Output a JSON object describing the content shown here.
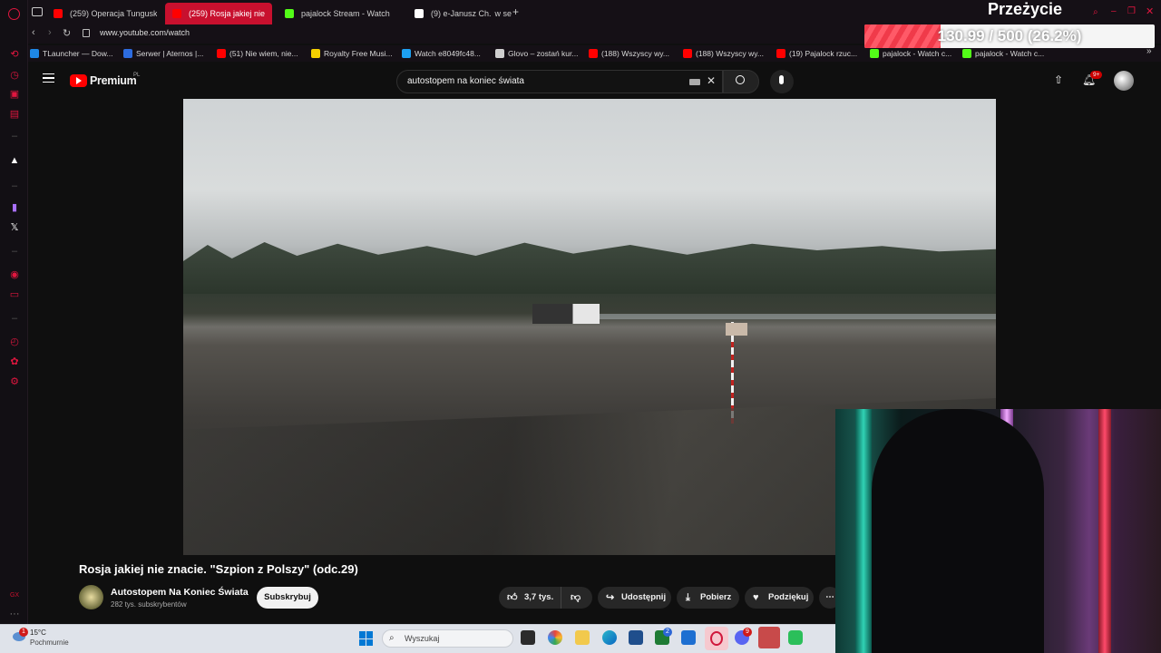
{
  "browser": {
    "tabs": [
      {
        "label": "(259) Operacja Tunguska",
        "color": "#ff0000",
        "active": false
      },
      {
        "label": "(259) Rosja jakiej nie",
        "color": "#ff0000",
        "active": true
      },
      {
        "label": "pajalock Stream - Watch",
        "color": "#53fc18",
        "active": false
      },
      {
        "label": "(9) e-Janusz Ch.",
        "color": "#ffffff",
        "active": false
      }
    ],
    "tab_suffix": "w se",
    "url": "www.youtube.com/watch",
    "bookmarks": [
      "TLauncher — Dow...",
      "Serwer | Aternos |...",
      "(51) Nie wiem, nie...",
      "Royalty Free Musi...",
      "Watch e8049fc48...",
      "Glovo – zostań kur...",
      "(188) Wszyscy wy...",
      "(188) Wszyscy wy...",
      "(19) Pajalock rzuc...",
      "pajalock - Watch c...",
      "pajalock - Watch c..."
    ],
    "bookmark_colors": [
      "#1e88e5",
      "#2d6cdf",
      "#ff0000",
      "#f5d000",
      "#1da1f2",
      "#cfcfcf",
      "#ff0000",
      "#ff0000",
      "#ff0000",
      "#53fc18",
      "#53fc18"
    ],
    "sidebar_badge": "GX"
  },
  "overlay": {
    "title": "Przeżycie",
    "goal_text": "130.99 / 500 (26.2%)",
    "goal_fraction": 0.262
  },
  "youtube": {
    "logo_text": "Premium",
    "logo_region": "PL",
    "search_value": "autostopem na koniec świata",
    "notification_badge": "9+",
    "video_title": "Rosja jakiej nie znacie. \"Szpion z Polszy\" (odc.29)",
    "channel_name": "Autostopem Na Koniec Świata",
    "subscribers": "282 tys. subskrybentów",
    "subscribe_label": "Subskrybuj",
    "likes": "3,7 tys.",
    "share_label": "Udostępnij",
    "download_label": "Pobierz",
    "thanks_label": "Podziękuj"
  },
  "taskbar": {
    "weather_temp": "15°C",
    "weather_desc": "Pochmurnie",
    "weather_badge": "1",
    "search_placeholder": "Wyszukaj",
    "badge_mail": "2",
    "badge_discord": "9"
  }
}
